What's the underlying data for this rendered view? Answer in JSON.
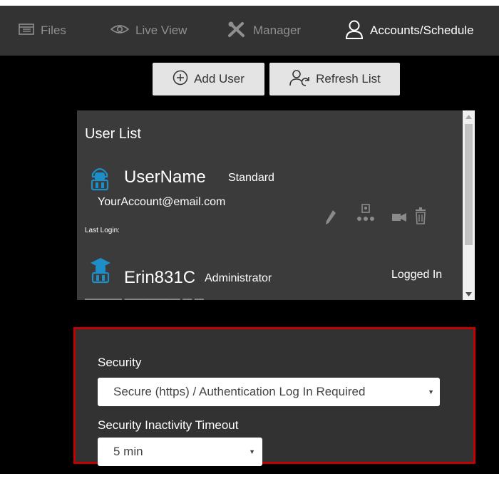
{
  "nav": {
    "items": [
      {
        "label": "Files",
        "icon": "files-icon"
      },
      {
        "label": "Live View",
        "icon": "eye-icon"
      },
      {
        "label": "Manager",
        "icon": "tools-icon"
      },
      {
        "label": "Accounts/Schedule",
        "icon": "person-icon",
        "active": true
      }
    ]
  },
  "toolbar": {
    "add_user_label": "Add User",
    "refresh_list_label": "Refresh List"
  },
  "user_list": {
    "title": "User List",
    "users": [
      {
        "name": "UserName",
        "role": "Standard",
        "email": "YourAccount@email.com",
        "last_login": "Last Login:"
      },
      {
        "name": "Erin831C",
        "role": "Administrator",
        "status": "Logged In"
      }
    ]
  },
  "security": {
    "label": "Security",
    "value": "Secure (https) / Authentication Log In Required",
    "timeout_label": "Security Inactivity Timeout",
    "timeout_value": "5 min"
  },
  "colors": {
    "navbar": "#333333",
    "background": "#000000",
    "panel": "#3b3b3b",
    "highlight_border": "#c40000",
    "user_icon": "#1e8fc6"
  }
}
